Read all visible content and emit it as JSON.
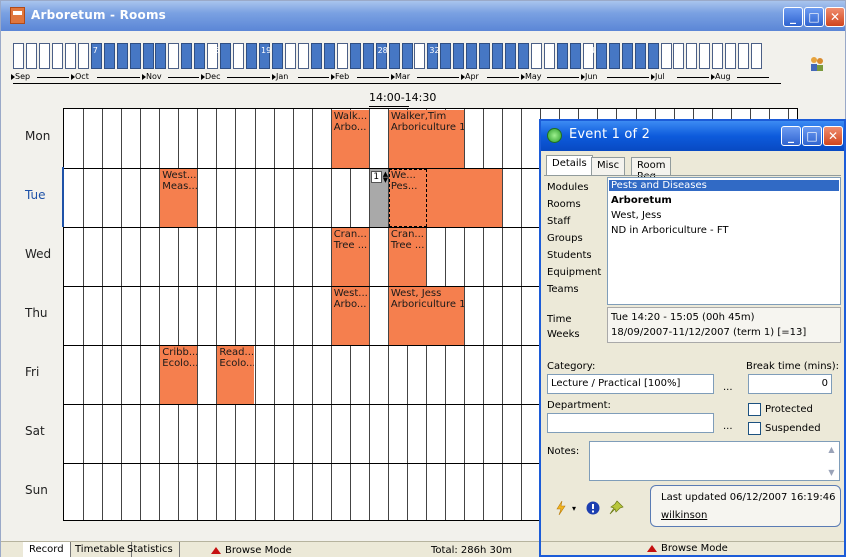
{
  "window": {
    "title": "Arboretum - Rooms"
  },
  "weeks": {
    "labels": [
      "7",
      "16",
      "19",
      "28",
      "32",
      "44"
    ]
  },
  "months": [
    "Sep",
    "Oct",
    "Nov",
    "Dec",
    "Jan",
    "Feb",
    "Mar",
    "Apr",
    "May",
    "Jun",
    "Jul",
    "Aug"
  ],
  "time_header": "14:00-14:30",
  "days": [
    "Mon",
    "Tue",
    "Wed",
    "Thu",
    "Fri",
    "Sat",
    "Sun"
  ],
  "events": [
    {
      "l1": "Walk...",
      "l2": "Arbo..."
    },
    {
      "l1": "Walker,Tim",
      "l2": "Arboriculture 1"
    },
    {
      "l1": "West...",
      "l2": "Meas..."
    },
    {
      "l1": "We...",
      "l2": "Pes..."
    },
    {
      "l1": "Cran...",
      "l2": "Tree ..."
    },
    {
      "l1": "Cran...",
      "l2": "Tree ..."
    },
    {
      "l1": "West...",
      "l2": "Arbo..."
    },
    {
      "l1": "West, Jess",
      "l2": "Arboriculture 1"
    },
    {
      "l1": "Cribb...",
      "l2": "Ecolo..."
    },
    {
      "l1": "Read...",
      "l2": "Ecolo..."
    }
  ],
  "clash_count": "1",
  "statusbar": {
    "tabs": [
      "Record",
      "Timetable",
      "Statistics"
    ],
    "mode": "Browse Mode",
    "total": "Total: 286h 30m",
    "dialog_mode": "Browse Mode"
  },
  "dialog": {
    "title": "Event 1 of 2",
    "tabs": [
      "Details",
      "Misc",
      "Room Req"
    ],
    "field_labels": [
      "Modules",
      "Rooms",
      "Staff",
      "Groups",
      "Students",
      "Equipment",
      "Teams"
    ],
    "field_values": [
      "Pests and Diseases",
      "Arboretum",
      "West, Jess",
      "ND in Arboriculture - FT"
    ],
    "time_label": "Time",
    "weeks_label": "Weeks",
    "time_value": "Tue 14:20 - 15:05 (00h 45m)",
    "weeks_value": "18/09/2007-11/12/2007 (term 1) [=13]",
    "category_label": "Category:",
    "category_value": "Lecture / Practical [100%]",
    "break_label": "Break time (mins):",
    "break_value": "0",
    "department_label": "Department:",
    "department_value": "",
    "protected_label": "Protected",
    "suspended_label": "Suspended",
    "notes_label": "Notes:",
    "ellipsis": "...",
    "last_updated": "Last updated  06/12/2007 16:19:46",
    "updated_by": "wilkinson"
  },
  "colors": {
    "event": "#f57f4e",
    "titlebar": "#0d5bdc",
    "week_on": "#4677c4",
    "selection": "#316ac5"
  }
}
